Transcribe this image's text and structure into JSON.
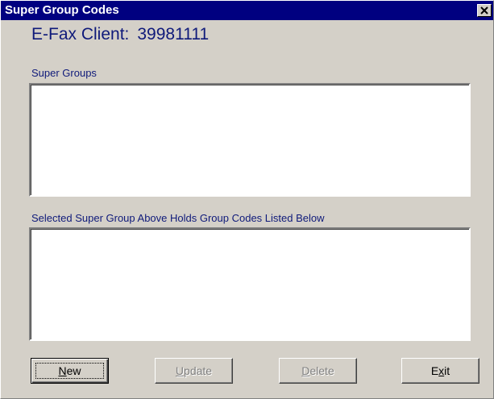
{
  "window": {
    "title": "Super Group Codes",
    "close_icon": "close-icon"
  },
  "client": {
    "label": "E-Fax Client:",
    "number": "39981111"
  },
  "super_groups": {
    "label": "Super Groups",
    "items": []
  },
  "group_codes": {
    "label": "Selected Super Group Above Holds Group Codes Listed Below",
    "items": []
  },
  "buttons": {
    "new": {
      "label": "New",
      "mnemonic": "N",
      "enabled": true,
      "focused": true
    },
    "update": {
      "label": "Update",
      "mnemonic": "U",
      "enabled": false
    },
    "delete": {
      "label": "Delete",
      "mnemonic": "D",
      "enabled": false
    },
    "exit": {
      "label": "Exit",
      "mnemonic": "x",
      "enabled": true
    }
  },
  "colors": {
    "titlebar": "#000080",
    "face": "#d4d0c8",
    "label_text": "#0f1a7a",
    "disabled_text": "#808080"
  }
}
